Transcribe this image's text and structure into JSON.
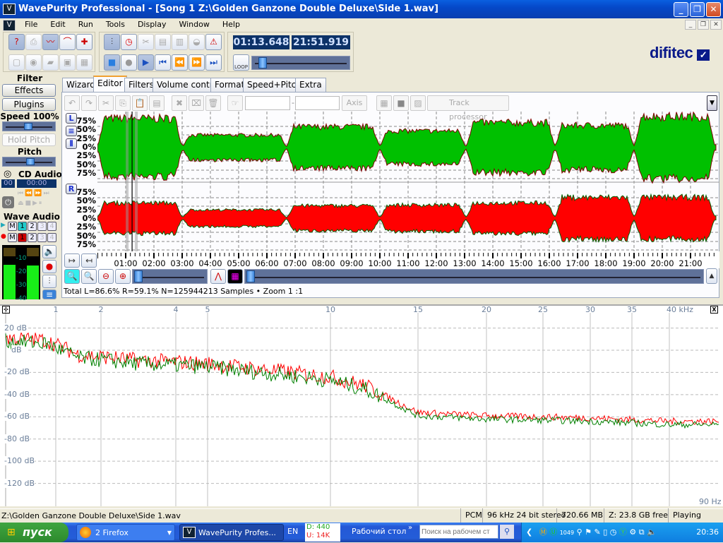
{
  "window": {
    "title": "WavePurity Professional - [Song 1  Z:\\Golden Ganzone Double Deluxe\\Side 1.wav]",
    "min": "_",
    "restore": "❐",
    "close": "✕"
  },
  "menu": [
    "File",
    "Edit",
    "Run",
    "Tools",
    "Display",
    "Window",
    "Help"
  ],
  "toolbar": {
    "time_position": "01:13.648",
    "time_total": "21:51.919",
    "loop_label": "LOOP",
    "position_fraction": 0.056
  },
  "logo": "difitec",
  "left_panel": {
    "filter_label": "Filter",
    "effects": "Effects",
    "plugins": "Plugins",
    "speed_label": "Speed 100%",
    "hold_pitch": "Hold Pitch",
    "pitch_label": "Pitch",
    "cd_label": "CD Audio",
    "cd_track": "00",
    "cd_time": "00:00",
    "wave_label": "Wave Audio",
    "play_buttons": [
      "M",
      "1",
      "2",
      "3",
      "4"
    ],
    "rec_buttons": [
      "M",
      "1",
      "2",
      "3",
      "4"
    ],
    "meter_ticks": [
      "-10",
      "-20",
      "-30",
      "-40"
    ],
    "meter_left_level": 0.82,
    "meter_right_level": 0.8
  },
  "tabs": [
    "Wizard",
    "Editor",
    "Filters",
    "Volume control",
    "Format",
    "Speed+Pitch",
    "Extra"
  ],
  "active_tab": "Editor",
  "editor": {
    "axis_label": "Axis",
    "track_processor": "Track processor",
    "range_from": "",
    "range_to": "",
    "left_channel": "L",
    "right_channel": "R",
    "amp_labels_left": [
      "75%",
      "50%",
      "25%",
      "0%",
      "25%",
      "50%",
      "75%"
    ],
    "amp_labels_right": [
      "75%",
      "50%",
      "25%",
      "0%",
      "25%",
      "50%",
      "75%"
    ],
    "time_labels": [
      "01:00",
      "02:00",
      "03:00",
      "04:00",
      "05:00",
      "06:00",
      "07:00",
      "08:00",
      "09:00",
      "10:00",
      "11:00",
      "12:00",
      "13:00",
      "14:00",
      "15:00",
      "16:00",
      "17:00",
      "18:00",
      "19:00",
      "20:00",
      "21:00"
    ],
    "duration_min": 21.865,
    "cursor_min": 1.227,
    "track_boundaries_min": [
      3.0,
      6.7,
      10.0,
      13.05,
      16.2,
      19.0
    ],
    "left_track_levels": [
      0.42,
      0.18,
      0.3,
      0.24,
      0.36,
      0.32,
      0.45,
      0.36
    ],
    "right_track_levels": [
      0.22,
      0.12,
      0.18,
      0.19,
      0.22,
      0.3,
      0.3,
      0.32
    ],
    "left_color": "#00c000",
    "right_color": "#ff0000",
    "status": "Total L=86.6% R=59.1% N=125944213 Samples • Zoom 1 :1"
  },
  "spectrum": {
    "freq_labels": [
      "1",
      "2",
      "4",
      "5",
      "10",
      "15",
      "20",
      "25",
      "30",
      "35",
      "40 kHz"
    ],
    "db_labels": [
      "20 dB",
      "dB",
      "-20 dB",
      "-40 dB",
      "-60 dB",
      "-80 dB",
      "-100 dB",
      "-120 dB"
    ],
    "corner_label": "90 Hz",
    "envelope_khz": [
      0,
      0.8,
      1.5,
      3,
      5,
      8,
      10,
      12,
      13.5,
      15,
      20,
      30,
      40
    ],
    "envelope_db": [
      10,
      8,
      -5,
      -10,
      -13,
      -20,
      -25,
      -33,
      -45,
      -57,
      -60,
      -62,
      -65
    ],
    "colors": {
      "left": "#ff0000",
      "right": "#008000"
    }
  },
  "statusbar": {
    "path": "Z:\\Golden Ganzone Double Deluxe\\Side 1.wav",
    "format": "PCM",
    "rate": "96 kHz 24 bit stereo",
    "size": "720.66 MB",
    "free": "Z: 23.8 GB free",
    "state": "Playing"
  },
  "taskbar": {
    "start": "пуск",
    "firefox": "2 Firefox",
    "wavepurity": "WavePurity Profes...",
    "lang": "EN",
    "net_down": "D: 440",
    "net_up": "U: 14K",
    "desktop": "Рабочий стол",
    "search_placeholder": "Поиск на рабочем ст",
    "tray_num": "1049",
    "clock": "20:36"
  }
}
